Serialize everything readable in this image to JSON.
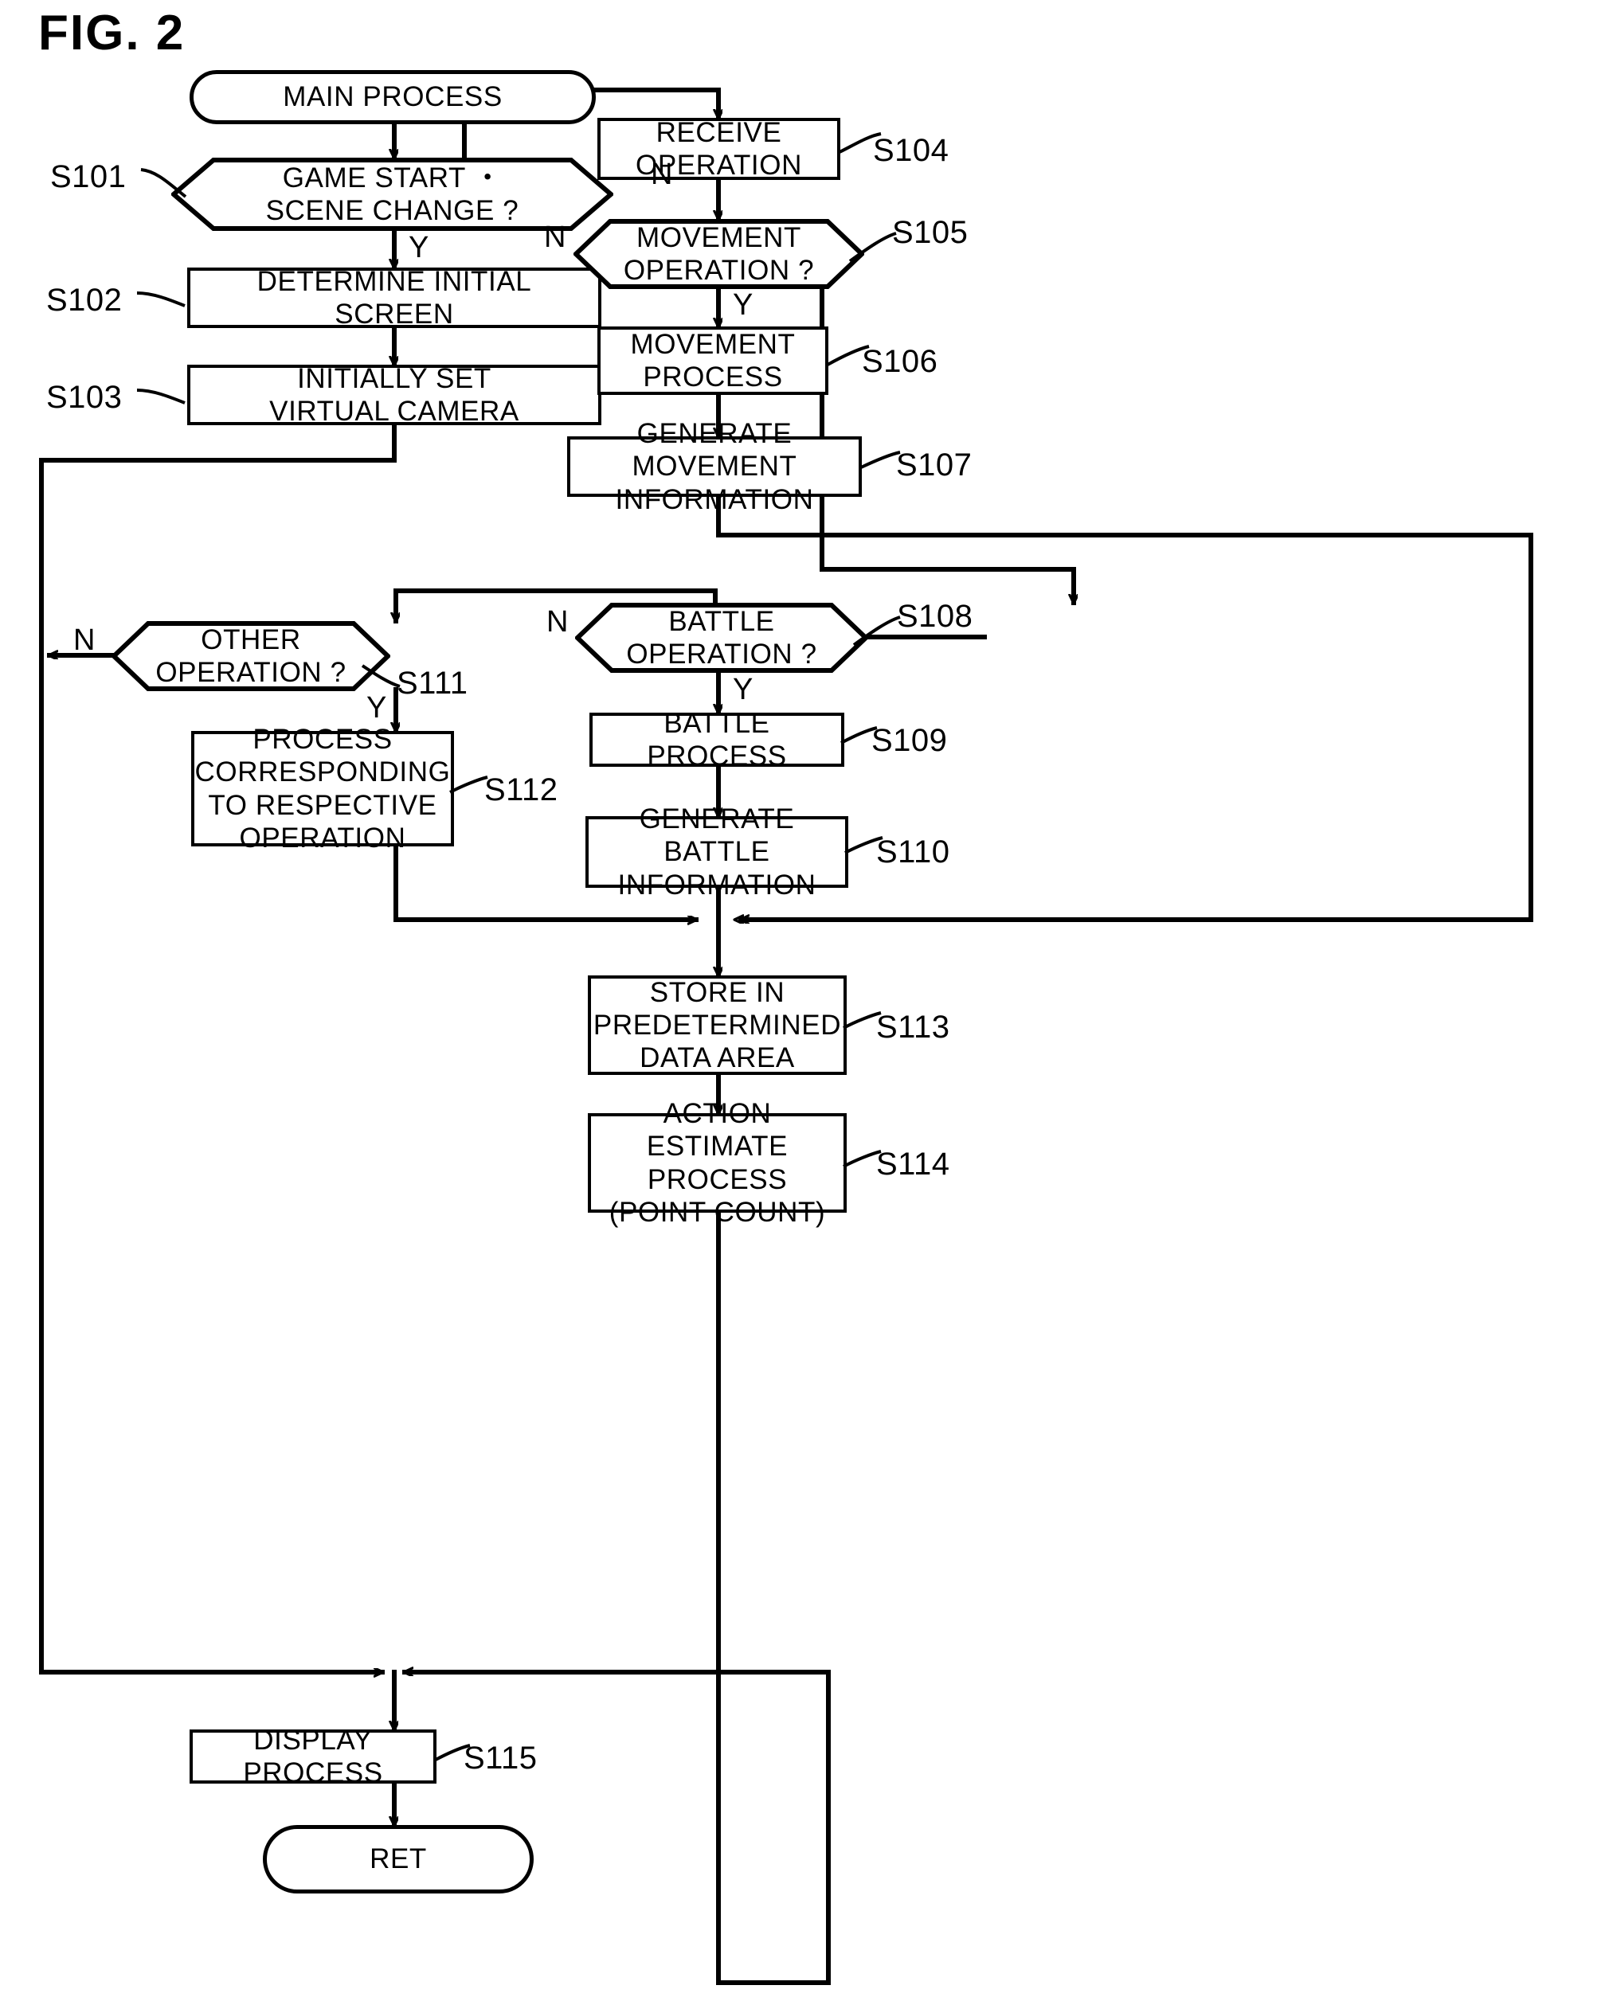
{
  "figure": {
    "title": "FIG. 2",
    "type": "flowchart"
  },
  "nodes": {
    "start": {
      "label": "MAIN PROCESS",
      "shape": "terminator"
    },
    "s101": {
      "label": "GAME START ・\nSCENE CHANGE ?",
      "shape": "decision",
      "step": "S101"
    },
    "s102": {
      "label": "DETERMINE INITIAL\nSCREEN",
      "shape": "process",
      "step": "S102"
    },
    "s103": {
      "label": "INITIALLY SET\nVIRTUAL CAMERA",
      "shape": "process",
      "step": "S103"
    },
    "s104": {
      "label": "RECEIVE\nOPERATION",
      "shape": "process",
      "step": "S104"
    },
    "s105": {
      "label": "MOVEMENT\nOPERATION ?",
      "shape": "decision",
      "step": "S105"
    },
    "s106": {
      "label": "MOVEMENT\nPROCESS",
      "shape": "process",
      "step": "S106"
    },
    "s107": {
      "label": "GENERATE MOVEMENT\nINFORMATION",
      "shape": "process",
      "step": "S107"
    },
    "s108": {
      "label": "BATTLE\nOPERATION ?",
      "shape": "decision",
      "step": "S108"
    },
    "s109": {
      "label": "BATTLE PROCESS",
      "shape": "process",
      "step": "S109"
    },
    "s110": {
      "label": "GENERATE BATTLE\nINFORMATION",
      "shape": "process",
      "step": "S110"
    },
    "s111": {
      "label": "OTHER\nOPERATION ?",
      "shape": "decision",
      "step": "S111"
    },
    "s112": {
      "label": "PROCESS\nCORRESPONDING\nTO RESPECTIVE\nOPERATION",
      "shape": "process",
      "step": "S112"
    },
    "s113": {
      "label": "STORE IN\nPREDETERMINED\nDATA AREA",
      "shape": "process",
      "step": "S113"
    },
    "s114": {
      "label": "ACTION ESTIMATE\nPROCESS\n(POINT COUNT)",
      "shape": "process",
      "step": "S114"
    },
    "s115": {
      "label": "DISPLAY PROCESS",
      "shape": "process",
      "step": "S115"
    },
    "ret": {
      "label": "RET",
      "shape": "terminator"
    }
  },
  "branches": {
    "s101_n": "N",
    "s101_y": "Y",
    "s105_n": "N",
    "s105_y": "Y",
    "s108_n": "N",
    "s108_y": "Y",
    "s111_n": "N",
    "s111_y": "Y"
  },
  "colors": {
    "ink": "#000000",
    "paper": "#ffffff"
  }
}
